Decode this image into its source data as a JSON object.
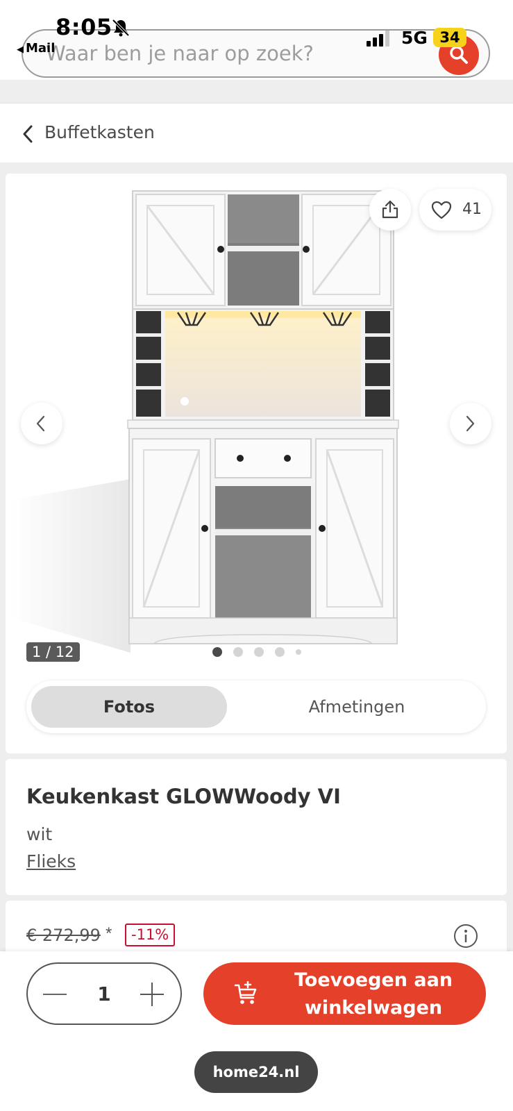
{
  "status_bar": {
    "time": "8:05",
    "back_app": "Mail",
    "network": "5G",
    "battery": "34"
  },
  "search": {
    "placeholder": "Waar ben je naar op zoek?"
  },
  "breadcrumb": {
    "label": "Buffetkasten"
  },
  "gallery": {
    "favorite_count": "41",
    "image_counter": "1 / 12",
    "tabs": [
      {
        "label": "Fotos",
        "active": true
      },
      {
        "label": "Afmetingen",
        "active": false
      }
    ]
  },
  "product": {
    "title": "Keukenkast GLOWWoody VI",
    "color": "wit",
    "brand": "Flieks"
  },
  "price": {
    "old_price": "€ 272,99",
    "asterisk": "*",
    "discount": "-11%"
  },
  "cart": {
    "quantity": "1",
    "add_label": "Toevoegen aan winkelwagen"
  },
  "browser": {
    "domain": "home24.nl"
  },
  "colors": {
    "accent": "#e4402a",
    "discount": "#c8102e"
  }
}
